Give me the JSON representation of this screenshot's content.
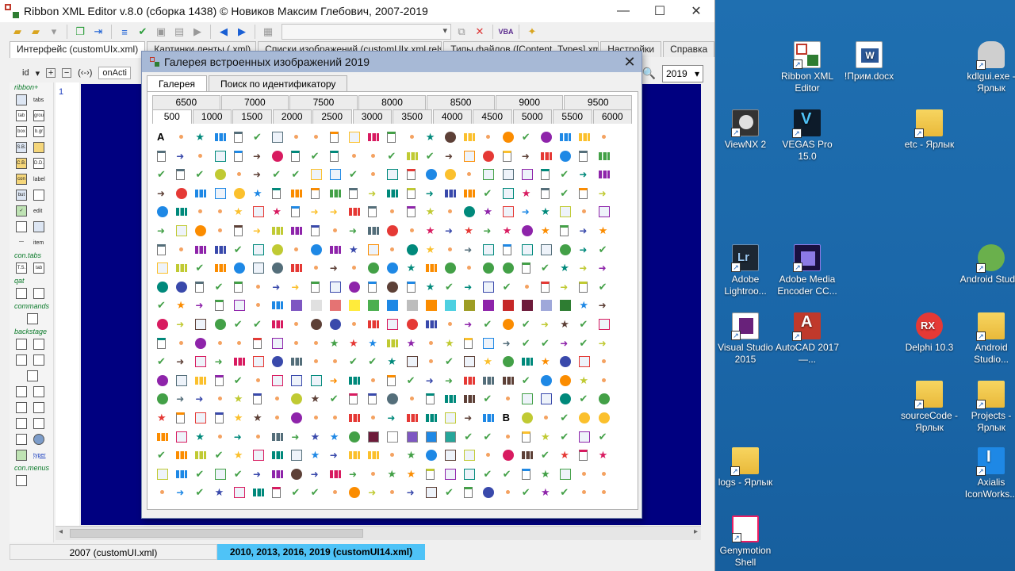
{
  "app": {
    "title": "Ribbon XML Editor v.8.0 (сборка 1438) © Новиков Максим Глебович, 2007-2019",
    "tabs": [
      "Интерфейс (customUIx.xml)",
      "Картинки ленты (.xml)",
      "Списки изображений (customUIx.xml.rels)",
      "Типы файлов ([Content_Types].xml)",
      "Настройки",
      "Справка"
    ],
    "sub_toolbar": {
      "id_label": "id",
      "dropdown_arrow": "▾",
      "nav_label": "(‹-›)",
      "field_value": "onActi"
    },
    "year_selected": "2019",
    "line_number": "1",
    "left_panel": {
      "sections": [
        "ribbon+",
        "con.tabs",
        "qat",
        "commands",
        "backstage",
        "con.menus"
      ],
      "labels": [
        "tabs",
        "tab",
        "group",
        "b.gr",
        "box",
        "label",
        "but ton",
        "edit",
        "item",
        "T.S.",
        "tab",
        "typer",
        "C.B.",
        "D.D.",
        "con trol",
        "S.B.",
        "SP",
        "bt"
      ]
    },
    "statusbar": {
      "left": "2007 (customUI.xml)",
      "right": "2010, 2013, 2016, 2019 (customUI14.xml)"
    }
  },
  "dialog": {
    "title": "Галерея встроенных изображений 2019",
    "close": "✕",
    "tabs": [
      "Галерея",
      "Поиск по идентификатору"
    ],
    "range_row1": [
      "6500",
      "7000",
      "7500",
      "8000",
      "8500",
      "9000",
      "9500"
    ],
    "range_row2": [
      "500",
      "1000",
      "1500",
      "2000",
      "2500",
      "3000",
      "3500",
      "4000",
      "4500",
      "5000",
      "5500",
      "6000"
    ],
    "active_range": "500",
    "bold_glyph": "B",
    "letter_glyph": "A"
  },
  "desktop_icons": [
    {
      "label": "Ribbon XML Editor",
      "icon": "ribbon-xml-icon"
    },
    {
      "label": "!Прим.docx",
      "icon": "word-doc-icon"
    },
    {
      "label": "kdlgui.exe - Ярлык",
      "icon": "person-exe-icon"
    },
    {
      "label": "ViewNX 2",
      "icon": "viewnx-icon"
    },
    {
      "label": "VEGAS Pro 15.0",
      "icon": "vegas-icon"
    },
    {
      "label": "etc - Ярлык",
      "icon": "folder-icon"
    },
    {
      "label": "Adobe Lightroo...",
      "icon": "lightroom-icon"
    },
    {
      "label": "Adobe Media Encoder CC...",
      "icon": "media-encoder-icon"
    },
    {
      "label": "Android Studio",
      "icon": "android-studio-icon"
    },
    {
      "label": "Visual Studio 2015",
      "icon": "visual-studio-icon"
    },
    {
      "label": "AutoCAD 2017 —...",
      "icon": "autocad-icon"
    },
    {
      "label": "Delphi 10.3",
      "icon": "delphi-icon"
    },
    {
      "label": "Android Studio...",
      "icon": "folder-icon"
    },
    {
      "label": "sourceCode - Ярлык",
      "icon": "folder-icon"
    },
    {
      "label": "Projects - Ярлык",
      "icon": "folder-icon"
    },
    {
      "label": "logs - Ярлык",
      "icon": "folder-icon"
    },
    {
      "label": "Axialis IconWorks...",
      "icon": "axialis-icon"
    },
    {
      "label": "Genymotion Shell",
      "icon": "genymotion-icon"
    }
  ],
  "colors": {
    "editor_bg": "#000080",
    "desktop_bg": "#1a66a8",
    "status_highlight": "#4fc3f7",
    "dialog_title_bg": "#a7b9d6"
  }
}
